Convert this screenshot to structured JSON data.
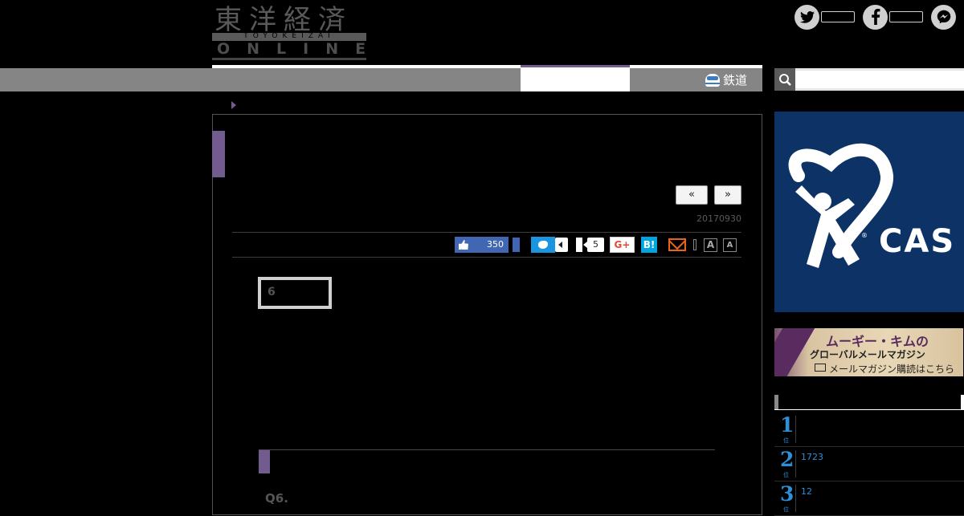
{
  "header": {
    "logo_kanji": "東洋経済",
    "logo_band": "TOYOKEIZAI",
    "logo_online": "ONLINE",
    "social": [
      {
        "icon": "twitter-icon",
        "color": "#d0d0d0"
      },
      {
        "icon": "facebook-icon",
        "color": "#d0d0d0"
      },
      {
        "icon": "messenger-icon",
        "color": "#d0d0d0"
      }
    ]
  },
  "nav": {
    "rail_label": "鉄道",
    "accent": "#725b8e"
  },
  "search": {
    "placeholder": "",
    "value": ""
  },
  "article": {
    "pager_prev": "«",
    "pager_next": "»",
    "date": "20170930",
    "share": {
      "fb_like_count": "350",
      "hatena_count": "5",
      "gplus_label": "G+",
      "hatena_label": "B!",
      "font_large": "A",
      "font_small": "A"
    },
    "question_box": "6",
    "paragraphs": [
      "",
      ""
    ],
    "heading": "",
    "q6_label": "Q6.",
    "q6_text": ""
  },
  "sidebar": {
    "ad_text": "CAS",
    "banner": {
      "title": "ムーギー・キムの",
      "subtitle": "グローバルメールマガジン",
      "cta": "メールマガジン購読はこちら"
    },
    "ranking": [
      {
        "rank": "1",
        "unit": "位",
        "text": ""
      },
      {
        "rank": "2",
        "unit": "位",
        "text": "1723"
      },
      {
        "rank": "3",
        "unit": "位",
        "text": "12"
      }
    ],
    "rank_color": "#2d8fd6"
  }
}
